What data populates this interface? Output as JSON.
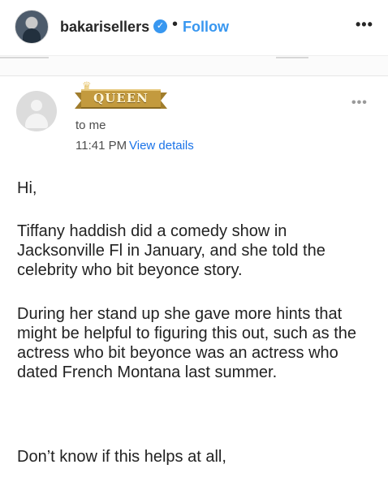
{
  "post_header": {
    "username": "bakarisellers",
    "verified_icon": "verified-badge-icon",
    "separator": "•",
    "follow_label": "Follow",
    "more_label": "•••"
  },
  "email": {
    "sender_banner_text": "QUEEN",
    "recipient": "to me",
    "time": "11:41 PM",
    "view_details": "View details",
    "more_label": "•••"
  },
  "body": {
    "greeting": "Hi,",
    "paragraph1": "Tiffany haddish did a comedy show in Jacksonville Fl in January, and she told the celebrity who bit beyonce story.",
    "paragraph2": "During her stand up she gave more hints that might be helpful to figuring this out, such as the actress who bit beyonce was an actress who dated French Montana last summer.",
    "paragraph3": "Don’t know if this helps at all,"
  },
  "colors": {
    "link_blue": "#3897f0",
    "gmail_blue": "#1a73e8",
    "banner_gold": "#c39a3e"
  }
}
